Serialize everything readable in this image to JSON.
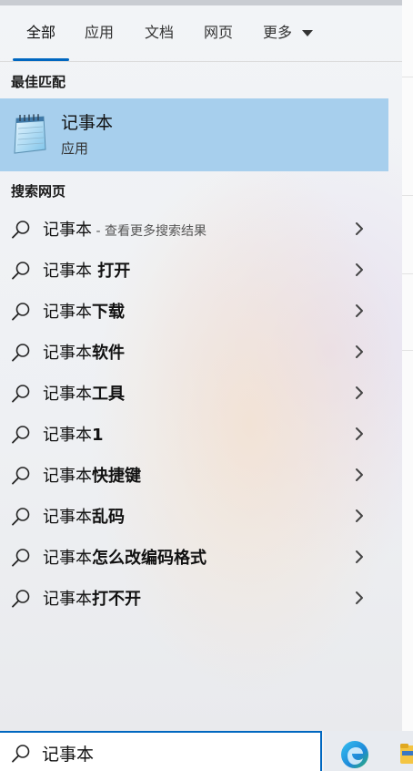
{
  "tabs": [
    {
      "label": "全部",
      "active": true
    },
    {
      "label": "应用"
    },
    {
      "label": "文档"
    },
    {
      "label": "网页"
    },
    {
      "label": "更多"
    }
  ],
  "best_match": {
    "section_title": "最佳匹配",
    "app_name": "记事本",
    "app_type": "应用",
    "icon": "notepad-icon"
  },
  "web": {
    "section_title": "搜索网页",
    "results": [
      {
        "prefix": "记事本",
        "suffix": " - 查看更多搜索结果",
        "suffix_style": "sub"
      },
      {
        "prefix": "记事本",
        "suffix": " 打开",
        "suffix_style": "bold"
      },
      {
        "prefix": "记事本",
        "suffix": "下载",
        "suffix_style": "bold"
      },
      {
        "prefix": "记事本",
        "suffix": "软件",
        "suffix_style": "bold"
      },
      {
        "prefix": "记事本",
        "suffix": "工具",
        "suffix_style": "bold"
      },
      {
        "prefix": "记事本",
        "suffix": "1",
        "suffix_style": "bold"
      },
      {
        "prefix": "记事本",
        "suffix": "快捷键",
        "suffix_style": "bold"
      },
      {
        "prefix": "记事本",
        "suffix": "乱码",
        "suffix_style": "bold"
      },
      {
        "prefix": "记事本",
        "suffix": "怎么改编码格式",
        "suffix_style": "bold"
      },
      {
        "prefix": "记事本",
        "suffix": "打不开",
        "suffix_style": "bold"
      }
    ]
  },
  "search": {
    "value": "记事本"
  },
  "taskbar": {
    "icons": [
      "edge-icon",
      "file-explorer-icon"
    ]
  },
  "colors": {
    "accent": "#0067c0",
    "highlight": "#a7cfed"
  }
}
